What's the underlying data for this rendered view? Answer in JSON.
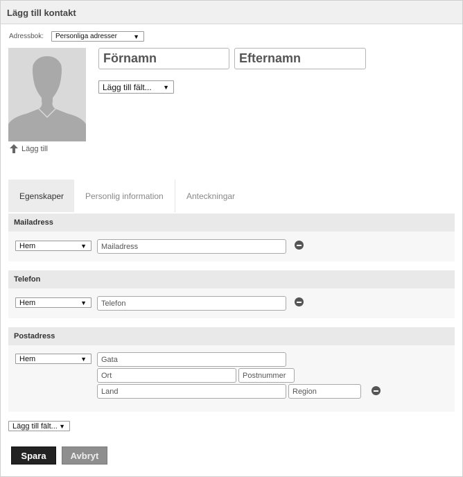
{
  "dialog": {
    "title": "Lägg till kontakt"
  },
  "addressbook": {
    "label": "Adressbok:",
    "selected": "Personliga adresser"
  },
  "contact": {
    "first_name_placeholder": "Förnamn",
    "last_name_placeholder": "Efternamn",
    "add_field_label": "Lägg till fält...",
    "upload_label": "Lägg till"
  },
  "tabs": [
    {
      "label": "Egenskaper"
    },
    {
      "label": "Personlig information"
    },
    {
      "label": "Anteckningar"
    }
  ],
  "sections": {
    "email": {
      "title": "Mailadress",
      "type": "Hem",
      "placeholder": "Mailadress"
    },
    "phone": {
      "title": "Telefon",
      "type": "Hem",
      "placeholder": "Telefon"
    },
    "address": {
      "title": "Postadress",
      "type": "Hem",
      "street_placeholder": "Gata",
      "city_placeholder": "Ort",
      "zip_placeholder": "Postnummer",
      "country_placeholder": "Land",
      "region_placeholder": "Region"
    }
  },
  "footer": {
    "add_field_label": "Lägg till fält...",
    "save_label": "Spara",
    "cancel_label": "Avbryt"
  }
}
